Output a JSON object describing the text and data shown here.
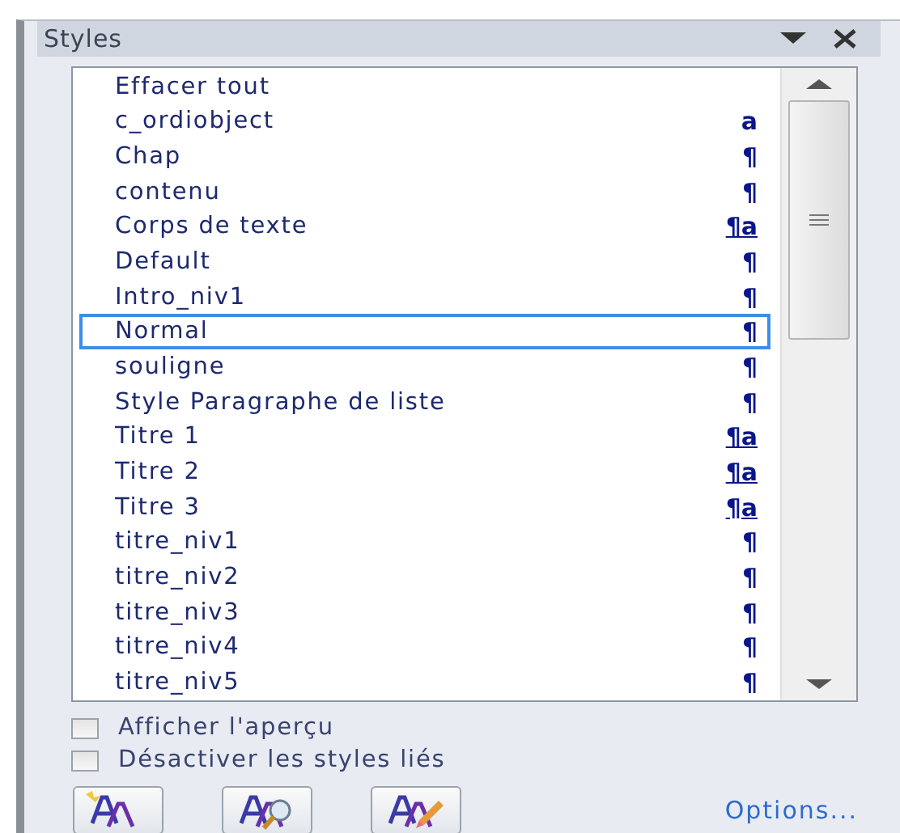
{
  "pane": {
    "title": "Styles"
  },
  "styles": [
    {
      "name": "Effacer tout",
      "kind": "none",
      "selected": false
    },
    {
      "name": "c_ordiobject",
      "kind": "character",
      "mark": "a",
      "selected": false
    },
    {
      "name": "Chap",
      "kind": "paragraph",
      "mark": "¶",
      "selected": false
    },
    {
      "name": "contenu",
      "kind": "paragraph",
      "mark": "¶",
      "selected": false
    },
    {
      "name": "Corps de texte",
      "kind": "linked",
      "mark": "¶a",
      "selected": false
    },
    {
      "name": "Default",
      "kind": "paragraph",
      "mark": "¶",
      "selected": false
    },
    {
      "name": "Intro_niv1",
      "kind": "paragraph",
      "mark": "¶",
      "selected": false
    },
    {
      "name": "Normal",
      "kind": "paragraph",
      "mark": "¶",
      "selected": true
    },
    {
      "name": "souligne",
      "kind": "paragraph",
      "mark": "¶",
      "selected": false
    },
    {
      "name": "Style Paragraphe de liste",
      "kind": "paragraph",
      "mark": "¶",
      "selected": false
    },
    {
      "name": "Titre 1",
      "kind": "linked",
      "mark": "¶a",
      "selected": false
    },
    {
      "name": "Titre 2",
      "kind": "linked",
      "mark": "¶a",
      "selected": false
    },
    {
      "name": "Titre 3",
      "kind": "linked",
      "mark": "¶a",
      "selected": false
    },
    {
      "name": "titre_niv1",
      "kind": "paragraph",
      "mark": "¶",
      "selected": false
    },
    {
      "name": "titre_niv2",
      "kind": "paragraph",
      "mark": "¶",
      "selected": false
    },
    {
      "name": "titre_niv3",
      "kind": "paragraph",
      "mark": "¶",
      "selected": false
    },
    {
      "name": "titre_niv4",
      "kind": "paragraph",
      "mark": "¶",
      "selected": false
    },
    {
      "name": "titre_niv5",
      "kind": "paragraph",
      "mark": "¶",
      "selected": false
    }
  ],
  "options": [
    {
      "label": "Afficher l'aperçu",
      "checked": false
    },
    {
      "label": "Désactiver les styles liés",
      "checked": false
    }
  ],
  "options_link": "Options..."
}
